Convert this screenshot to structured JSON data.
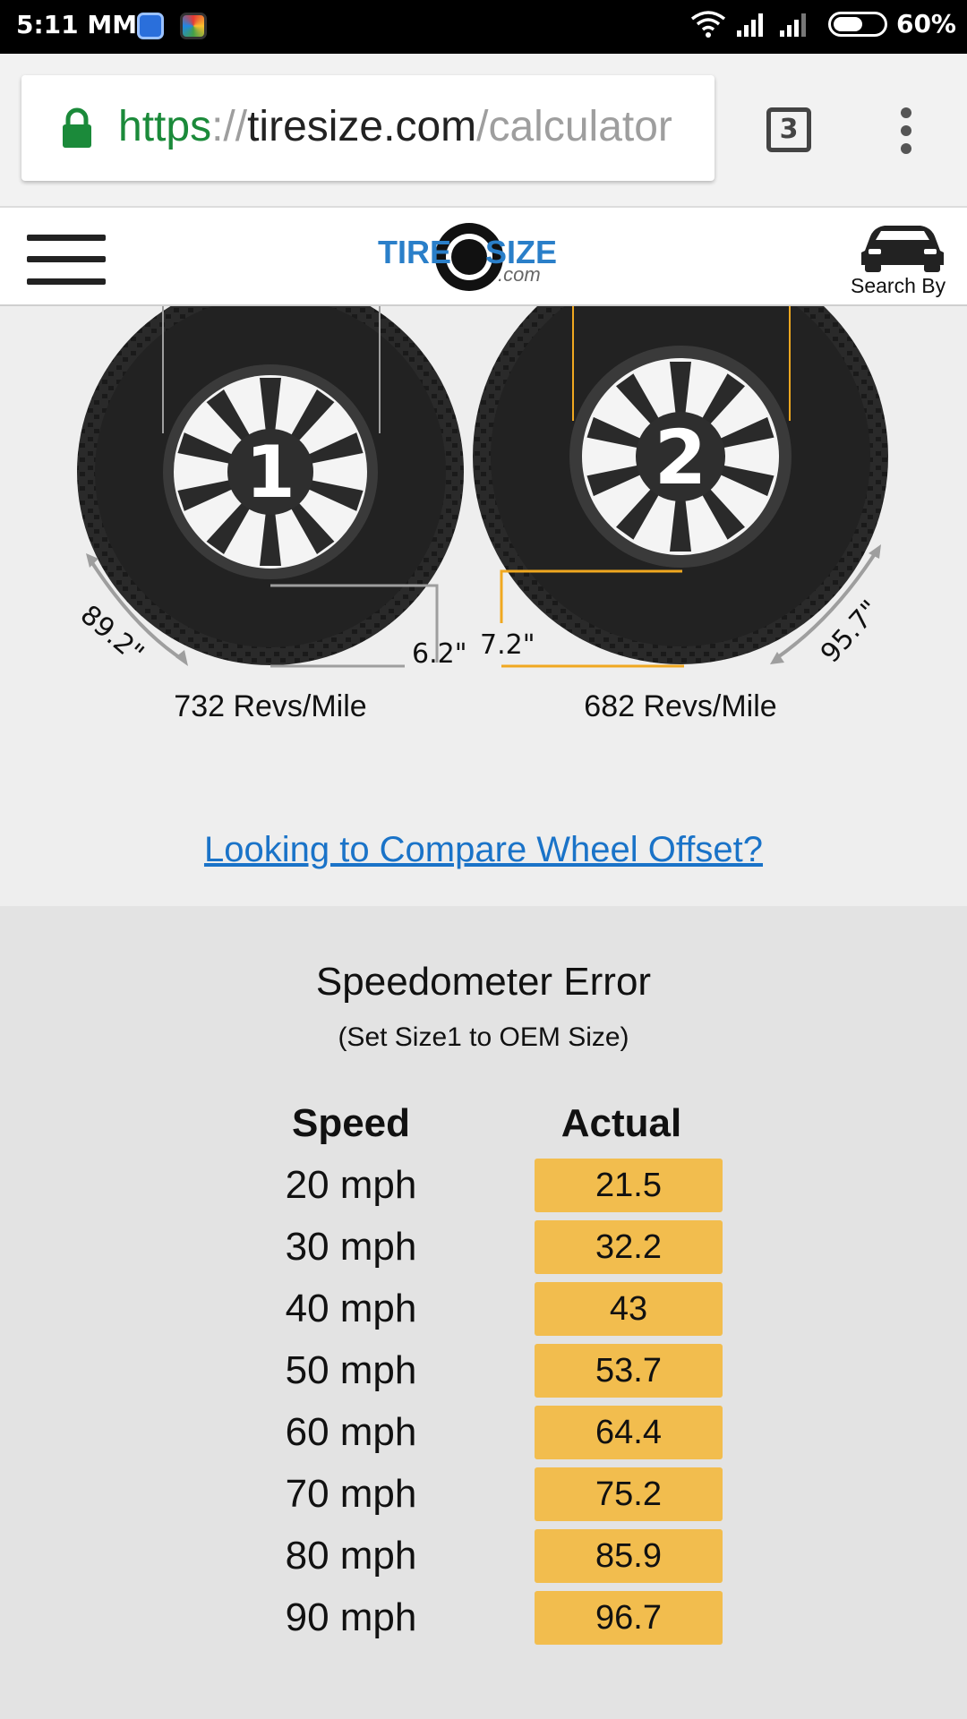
{
  "status_bar": {
    "time": "5:11 MM",
    "battery_percent": "60%",
    "battery_level": 0.6
  },
  "browser": {
    "url_scheme": "https",
    "url_separator": "://",
    "url_host": "tiresize.com",
    "url_path": "/calculator",
    "tab_count": "3"
  },
  "site_header": {
    "logo_text_1": "TIRE",
    "logo_text_2": "SIZE",
    "logo_text_3": ".com",
    "search_by_label": "Search By"
  },
  "tires": {
    "tire1": {
      "number": "1",
      "circumference": "89.2\"",
      "sidewall": "6.2\"",
      "revs": "732 Revs/Mile",
      "marker_color": "#9e9e9e"
    },
    "tire2": {
      "number": "2",
      "circumference": "95.7\"",
      "sidewall": "7.2\"",
      "revs": "682 Revs/Mile",
      "marker_color": "#f0a820"
    }
  },
  "compare_link": "Looking to Compare Wheel Offset?",
  "speedometer": {
    "title": "Speedometer Error",
    "subtitle": "(Set Size1 to OEM Size)",
    "speed_header": "Speed",
    "actual_header": "Actual",
    "rows": [
      {
        "speed": "20 mph",
        "actual": "21.5"
      },
      {
        "speed": "30 mph",
        "actual": "32.2"
      },
      {
        "speed": "40 mph",
        "actual": "43"
      },
      {
        "speed": "50 mph",
        "actual": "53.7"
      },
      {
        "speed": "60 mph",
        "actual": "64.4"
      },
      {
        "speed": "70 mph",
        "actual": "75.2"
      },
      {
        "speed": "80 mph",
        "actual": "85.9"
      },
      {
        "speed": "90 mph",
        "actual": "96.7"
      }
    ]
  },
  "colors": {
    "link": "#1a73c8",
    "actual_highlight": "#f2bd4e",
    "secure_green": "#1b8a3a"
  }
}
